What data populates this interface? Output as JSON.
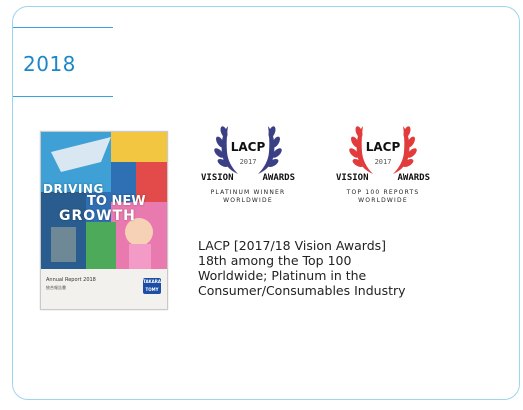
{
  "section": {
    "year": "2018"
  },
  "report_cover": {
    "title_lines": [
      "DRIVING",
      "TO NEW",
      "GROWTH"
    ],
    "report_label": "Annual Report 2018",
    "subtitle": "統合報告書",
    "logo_text": "TAKARA TOMY"
  },
  "awards": [
    {
      "org": "LACP",
      "year": "2017",
      "left": "VISION",
      "right": "AWARDS",
      "line1": "PLATINUM WINNER",
      "line2": "WORLDWIDE",
      "color": "#3b3f86"
    },
    {
      "org": "LACP",
      "year": "2017",
      "left": "VISION",
      "right": "AWARDS",
      "line1": "TOP 100 REPORTS",
      "line2": "WORLDWIDE",
      "color": "#e23b3b"
    }
  ],
  "caption_lines": [
    "LACP [2017/18 Vision Awards]",
    "18th among the Top 100",
    "Worldwide; Platinum in the",
    "Consumer/Consumables Industry"
  ],
  "colors": {
    "accent": "#1d86c8",
    "border": "#9fd4ee"
  }
}
